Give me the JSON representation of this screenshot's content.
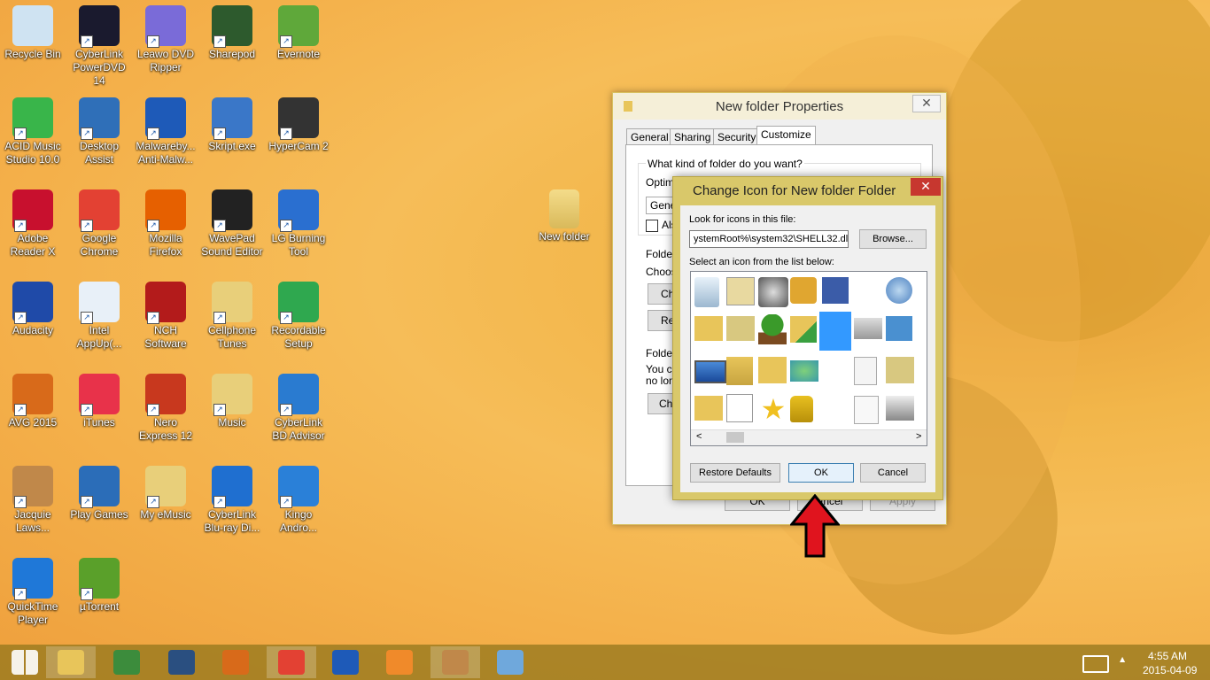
{
  "desktop": {
    "icons": [
      {
        "label": "Recycle Bin",
        "icon": "recycle-bin-icon",
        "color": "#cfe3f2"
      },
      {
        "label": "CyberLink PowerDVD 14",
        "icon": "powerdvd-icon",
        "color": "#1a1a2e"
      },
      {
        "label": "Leawo DVD Ripper",
        "icon": "dvd-ripper-icon",
        "color": "#7a6bd8"
      },
      {
        "label": "Sharepod",
        "icon": "sharepod-icon",
        "color": "#2d5a2d"
      },
      {
        "label": "Evernote",
        "icon": "evernote-icon",
        "color": "#5fa83a"
      },
      {
        "label": "ACID Music Studio 10.0",
        "icon": "acid-music-icon",
        "color": "#39b54a"
      },
      {
        "label": "Desktop Assist",
        "icon": "desktop-assist-icon",
        "color": "#2f6fb8"
      },
      {
        "label": "Malwareby... Anti-Malw...",
        "icon": "malwarebytes-icon",
        "color": "#1e5ab8"
      },
      {
        "label": "Skript.exe",
        "icon": "skript-icon",
        "color": "#3a77c8"
      },
      {
        "label": "HyperCam 2",
        "icon": "hypercam-icon",
        "color": "#333333"
      },
      {
        "label": "Adobe Reader X",
        "icon": "adobe-reader-icon",
        "color": "#c8102e"
      },
      {
        "label": "Google Chrome",
        "icon": "chrome-icon",
        "color": "#e34133"
      },
      {
        "label": "Mozilla Firefox",
        "icon": "firefox-icon",
        "color": "#e66000"
      },
      {
        "label": "WavePad Sound Editor",
        "icon": "wavepad-icon",
        "color": "#222222"
      },
      {
        "label": "LG Burning Tool",
        "icon": "lg-burning-icon",
        "color": "#2a6fd0"
      },
      {
        "label": "Audacity",
        "icon": "audacity-icon",
        "color": "#1f4aa8"
      },
      {
        "label": "Intel AppUp(...",
        "icon": "intel-appup-icon",
        "color": "#e8f0f8"
      },
      {
        "label": "NCH Software",
        "icon": "nch-icon",
        "color": "#b31b1b"
      },
      {
        "label": "Cellphone Tunes",
        "icon": "folder-icon",
        "color": "#e8cf7a"
      },
      {
        "label": "Recordable Setup",
        "icon": "recordable-icon",
        "color": "#2fa84f"
      },
      {
        "label": "AVG 2015",
        "icon": "avg-icon",
        "color": "#d86a1a"
      },
      {
        "label": "iTunes",
        "icon": "itunes-icon",
        "color": "#e8324a"
      },
      {
        "label": "Nero Express 12",
        "icon": "nero-icon",
        "color": "#c8381e"
      },
      {
        "label": "Music",
        "icon": "folder-icon",
        "color": "#e8cf7a"
      },
      {
        "label": "CyberLink BD Advisor",
        "icon": "bd-advisor-icon",
        "color": "#2a7bd0"
      },
      {
        "label": "Jacquie Laws...",
        "icon": "jacquie-icon",
        "color": "#c0884a"
      },
      {
        "label": "Play Games",
        "icon": "play-games-icon",
        "color": "#2b6db8"
      },
      {
        "label": "My eMusic",
        "icon": "folder-icon",
        "color": "#e8cf7a"
      },
      {
        "label": "CyberLink Blu-ray Di...",
        "icon": "bluray-icon",
        "color": "#1f6fd0"
      },
      {
        "label": "Kingo Andro...",
        "icon": "kingo-icon",
        "color": "#2a80d8"
      },
      {
        "label": "QuickTime Player",
        "icon": "quicktime-icon",
        "color": "#1f78d8"
      },
      {
        "label": "µTorrent",
        "icon": "utorrent-icon",
        "color": "#5aa02a"
      }
    ],
    "new_folder_label": "New folder"
  },
  "properties_dialog": {
    "title": "New folder Properties",
    "close": "✕",
    "tabs": [
      "General",
      "Sharing",
      "Security",
      "Customize"
    ],
    "question": "What kind of folder do you want?",
    "optimize_partial": "Optimi",
    "dropdown_partial": "Gene",
    "checkbox_partial": "Als",
    "folder_pictures_partial": "Folder",
    "choose_partial": "Choos",
    "choose_btn_partial": "Ch",
    "restore_btn_partial": "Res",
    "folder_icons_partial": "Folder",
    "you_can_partial": "You ca",
    "no_longer_partial": "no lon",
    "change_btn_partial": "Cha",
    "ok": "OK",
    "cancel_partial": "ancel",
    "apply": "Apply"
  },
  "change_icon_dialog": {
    "title": "Change Icon for New folder Folder",
    "close": "✕",
    "look_label": "Look for icons in this file:",
    "file_path": "ystemRoot%\\system32\\SHELL32.dll",
    "browse": "Browse...",
    "select_label": "Select an icon from the list below:",
    "restore_defaults": "Restore Defaults",
    "ok": "OK",
    "cancel": "Cancel",
    "scroll_left": "<",
    "scroll_right": ">"
  },
  "taskbar": {
    "items": [
      {
        "icon": "start-windows-icon",
        "color": "#ffffff"
      },
      {
        "icon": "file-explorer-icon",
        "color": "#e8c55a"
      },
      {
        "icon": "play-games-taskbar-icon",
        "color": "#3c8c3c"
      },
      {
        "icon": "video-player-icon",
        "color": "#2a4f80"
      },
      {
        "icon": "avg-taskbar-icon",
        "color": "#d86a1a"
      },
      {
        "icon": "chrome-taskbar-icon",
        "color": "#e34133"
      },
      {
        "icon": "malwarebytes-taskbar-icon",
        "color": "#1e5ab8"
      },
      {
        "icon": "media-taskbar-icon",
        "color": "#f08a2a"
      },
      {
        "icon": "jacquie-taskbar-icon",
        "color": "#c0884a"
      },
      {
        "icon": "paint-taskbar-icon",
        "color": "#6fa8dc"
      }
    ],
    "keyboard_icon": "keyboard-icon",
    "tray_arrow": "▲",
    "time": "4:55 AM",
    "date": "2015-04-09"
  },
  "colors": {
    "accent_red": "#e81123",
    "arrow_red": "#e0141e",
    "selection": "#3399ff"
  }
}
